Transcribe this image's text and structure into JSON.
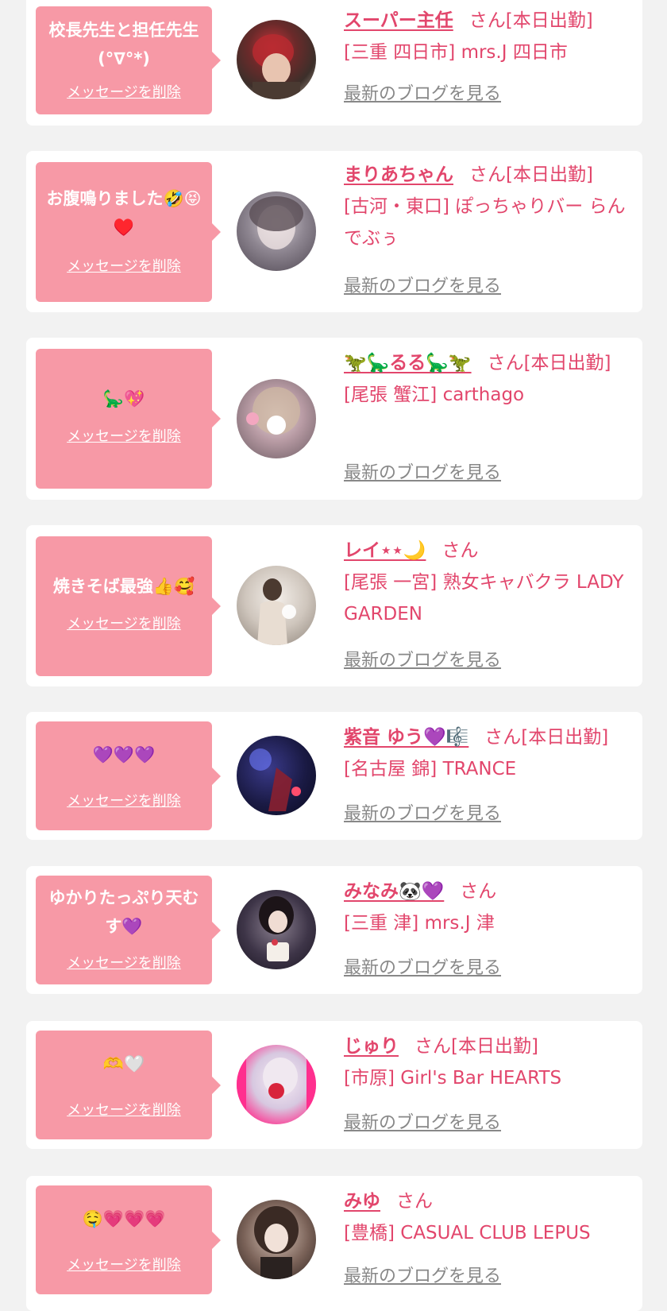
{
  "delete_label": "メッセージを削除",
  "blog_label": "最新のブログを見る",
  "honorific": "さん",
  "cards": [
    {
      "message": "校長先生と担任先生(°∇°*)",
      "name": "スーパー主任",
      "status": "[本日出勤]",
      "shop": "[三重 四日市] mrs.J 四日市"
    },
    {
      "message": "お腹鳴りました🤣😝♥️",
      "name": "まりあちゃん",
      "status": "[本日出勤]",
      "shop": "[古河・東口] ぽっちゃりバー らんでぶぅ"
    },
    {
      "message": "🦕💖",
      "name": "🦖🦕るる🦕🦖",
      "status": "[本日出勤]",
      "shop": "[尾張 蟹江] carthago"
    },
    {
      "message": "焼きそば最強👍🥰",
      "name": "レイ⋆⋆🌙",
      "status": "",
      "shop": "[尾張 一宮] 熟女キャバクラ LADY GARDEN"
    },
    {
      "message": "💜💜💜",
      "name": "紫音 ゆう💜🎼",
      "status": "[本日出勤]",
      "shop": "[名古屋 錦] TRANCE"
    },
    {
      "message": "ゆかりたっぷり天むす💜",
      "name": "みなみ🐼💜",
      "status": "",
      "shop": "[三重 津] mrs.J 津"
    },
    {
      "message": "🫶🤍",
      "name": "じゅり",
      "status": "[本日出勤]",
      "shop": "[市原] Girl's Bar HEARTS"
    },
    {
      "message": "🤤💗💗💗",
      "name": "みゆ",
      "status": "",
      "shop": "[豊橋] CASUAL CLUB LEPUS"
    }
  ],
  "colors": {
    "page_background": "#f2f2f2",
    "card_background": "#ffffff",
    "bubble": "#f799a6",
    "accent_pink": "#e2466c",
    "link_gray": "#888888"
  }
}
